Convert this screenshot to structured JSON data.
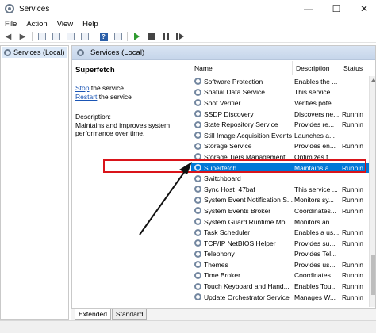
{
  "window": {
    "title": "Services",
    "minimize_glyph": "—",
    "maximize_glyph": "☐",
    "close_glyph": "✕"
  },
  "menu": [
    "File",
    "Action",
    "View",
    "Help"
  ],
  "toolbar": {
    "icons": [
      "back-icon",
      "forward-icon",
      "console-tree-icon",
      "properties-icon",
      "refresh-icon",
      "export-icon",
      "help-icon",
      "start-icon",
      "stop-icon",
      "pause-icon",
      "restart-icon"
    ],
    "help_label": "?"
  },
  "tree": {
    "item_label": "Services (Local)"
  },
  "content": {
    "header_title": "Services (Local)",
    "selected_service": "Superfetch",
    "stop_link": "Stop",
    "stop_suffix": " the service",
    "restart_link": "Restart",
    "restart_suffix": " the service",
    "description_label": "Description:",
    "description_text": "Maintains and improves system performance over time."
  },
  "table": {
    "columns": [
      "Name",
      "Description",
      "Status"
    ],
    "rows": [
      {
        "name": "Software Protection",
        "description": "Enables the ...",
        "status": ""
      },
      {
        "name": "Spatial Data Service",
        "description": "This service ...",
        "status": ""
      },
      {
        "name": "Spot Verifier",
        "description": "Verifies pote...",
        "status": ""
      },
      {
        "name": "SSDP Discovery",
        "description": "Discovers ne...",
        "status": "Runnin"
      },
      {
        "name": "State Repository Service",
        "description": "Provides re...",
        "status": "Runnin"
      },
      {
        "name": "Still Image Acquisition Events",
        "description": "Launches a...",
        "status": ""
      },
      {
        "name": "Storage Service",
        "description": "Provides en...",
        "status": "Runnin"
      },
      {
        "name": "Storage Tiers Management",
        "description": "Optimizes t...",
        "status": ""
      },
      {
        "name": "Superfetch",
        "description": "Maintains a...",
        "status": "Runnin",
        "selected": true
      },
      {
        "name": "Switchboard",
        "description": "",
        "status": ""
      },
      {
        "name": "Sync Host_47baf",
        "description": "This service ...",
        "status": "Runnin"
      },
      {
        "name": "System Event Notification S...",
        "description": "Monitors sy...",
        "status": "Runnin"
      },
      {
        "name": "System Events Broker",
        "description": "Coordinates...",
        "status": "Runnin"
      },
      {
        "name": "System Guard Runtime Mo...",
        "description": "Monitors an...",
        "status": ""
      },
      {
        "name": "Task Scheduler",
        "description": "Enables a us...",
        "status": "Runnin"
      },
      {
        "name": "TCP/IP NetBIOS Helper",
        "description": "Provides su...",
        "status": "Runnin"
      },
      {
        "name": "Telephony",
        "description": "Provides Tel...",
        "status": ""
      },
      {
        "name": "Themes",
        "description": "Provides us...",
        "status": "Runnin"
      },
      {
        "name": "Time Broker",
        "description": "Coordinates...",
        "status": "Runnin"
      },
      {
        "name": "Touch Keyboard and Hand...",
        "description": "Enables Tou...",
        "status": "Runnin"
      },
      {
        "name": "Update Orchestrator Service",
        "description": "Manages W...",
        "status": "Runnin"
      }
    ]
  },
  "tabs": [
    "Extended",
    "Standard"
  ],
  "colors": {
    "selection": "#0078d7",
    "highlight_box": "#d9141a",
    "link": "#1a55b5"
  }
}
